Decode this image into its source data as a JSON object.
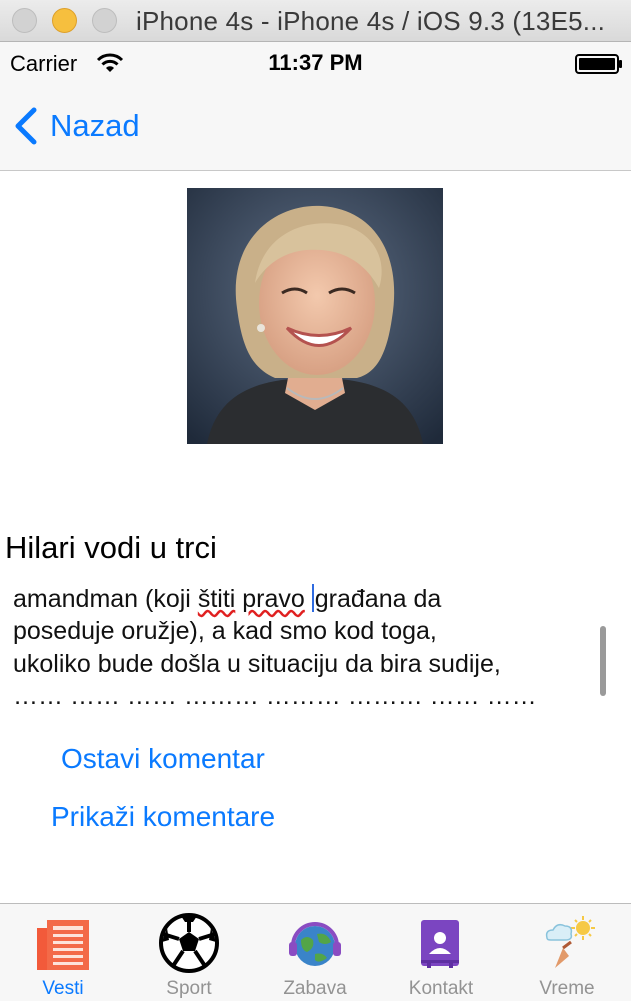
{
  "window": {
    "title": "iPhone 4s - iPhone 4s / iOS 9.3 (13E5..."
  },
  "status_bar": {
    "carrier": "Carrier",
    "time": "11:37 PM"
  },
  "nav": {
    "back_label": "Nazad"
  },
  "article": {
    "image_icon": "portrait-photo",
    "title": "Hilari vodi u trci",
    "body": {
      "partial_top": "…………… …",
      "line1_a": "amandman (koji ",
      "line1_b": "štiti",
      "line1_c": " ",
      "line1_d": "pravo",
      "line1_e": " ",
      "line1_f": "građana da",
      "line2": "poseduje oružje), a kad smo kod toga,",
      "line3": "ukoliko bude došla u situaciju da bira sudije,",
      "line4": "…… …… …… ……… ……… ……… …… ……"
    }
  },
  "actions": {
    "leave_comment": "Ostavi komentar",
    "show_comments": "Prikaži komentare"
  },
  "tabs": [
    {
      "label": "Vesti",
      "icon": "newspaper-icon",
      "active": true
    },
    {
      "label": "Sport",
      "icon": "soccer-ball-icon",
      "active": false
    },
    {
      "label": "Zabava",
      "icon": "globe-headphones-icon",
      "active": false
    },
    {
      "label": "Kontakt",
      "icon": "contact-card-icon",
      "active": false
    },
    {
      "label": "Vreme",
      "icon": "weather-icon",
      "active": false
    }
  ],
  "colors": {
    "accent": "#0a7aff",
    "tab_inactive": "#939393",
    "spellcheck": "#e02020"
  }
}
